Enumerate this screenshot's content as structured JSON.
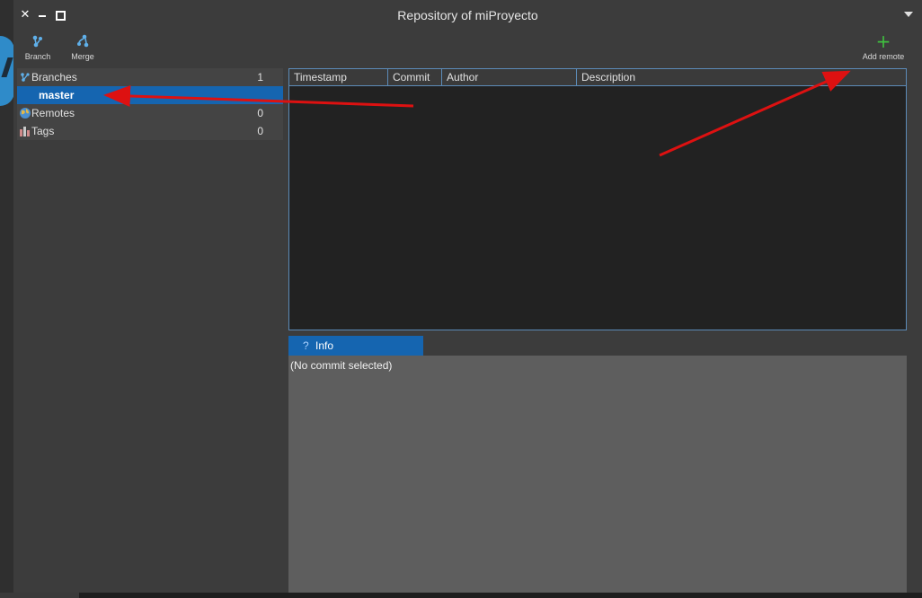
{
  "window": {
    "title": "Repository of miProyecto",
    "close_glyph": "✕"
  },
  "toolbar": {
    "branch_label": "Branch",
    "merge_label": "Merge",
    "add_remote_label": "Add remote",
    "add_glyph": "+"
  },
  "sidebar": {
    "branches": {
      "label": "Branches",
      "count": "1"
    },
    "selected_branch": "master",
    "remotes": {
      "label": "Remotes",
      "count": "0"
    },
    "tags": {
      "label": "Tags",
      "count": "0"
    }
  },
  "commits": {
    "columns": [
      "Timestamp",
      "Commit",
      "Author",
      "Description"
    ],
    "rows": []
  },
  "info": {
    "tab_icon": "?",
    "tab_label": "Info",
    "message": "(No commit selected)"
  },
  "colors": {
    "window_bg": "#3c3c3c",
    "selection": "#1565b0",
    "table_bg": "#222222",
    "info_bg": "#5e5e5e",
    "annotation_arrow": "#dd1111",
    "add_icon": "#3fbf3f"
  },
  "icons": [
    "close-icon",
    "minimize-icon",
    "maximize-icon",
    "menu-arrow-icon",
    "branch-icon",
    "merge-icon",
    "plus-icon",
    "globe-icon",
    "tags-icon",
    "question-icon"
  ]
}
